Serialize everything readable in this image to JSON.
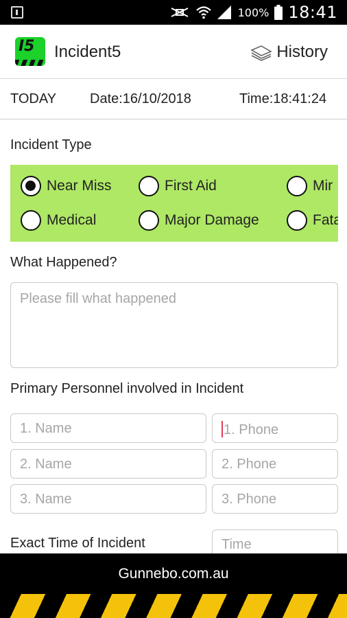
{
  "status_bar": {
    "battery_percent": "100%",
    "time": "18:41",
    "icons": [
      "notification-icon",
      "mute-icon",
      "wifi-icon",
      "signal-icon",
      "battery-icon"
    ]
  },
  "app_bar": {
    "logo_text": "I5",
    "title": "Incident5",
    "history_label": "History",
    "logo_color": "#1bd12a"
  },
  "date_row": {
    "today": "TODAY",
    "date": "Date:16/10/2018",
    "time": "Time:18:41:24"
  },
  "incident_type": {
    "label": "Incident Type",
    "panel_color": "#aee864",
    "options": [
      {
        "label": "Near Miss",
        "selected": true
      },
      {
        "label": "First Aid",
        "selected": false
      },
      {
        "label": "Mir",
        "selected": false
      },
      {
        "label": "Medical",
        "selected": false
      },
      {
        "label": "Major Damage",
        "selected": false
      },
      {
        "label": "Fata",
        "selected": false
      }
    ]
  },
  "what_happened": {
    "label": "What Happened?",
    "placeholder": "Please fill what happened",
    "value": ""
  },
  "personnel": {
    "label": "Primary Personnel involved in Incident",
    "rows": [
      {
        "name_placeholder": "1. Name",
        "phone_placeholder": "1. Phone"
      },
      {
        "name_placeholder": "2. Name",
        "phone_placeholder": "2. Phone"
      },
      {
        "name_placeholder": "3. Name",
        "phone_placeholder": "3. Phone"
      }
    ]
  },
  "exact_time": {
    "label": "Exact Time of Incident",
    "placeholder": "Time"
  },
  "footer": {
    "text": "Gunnebo.com.au",
    "stripe_color": "#f4c20a"
  }
}
